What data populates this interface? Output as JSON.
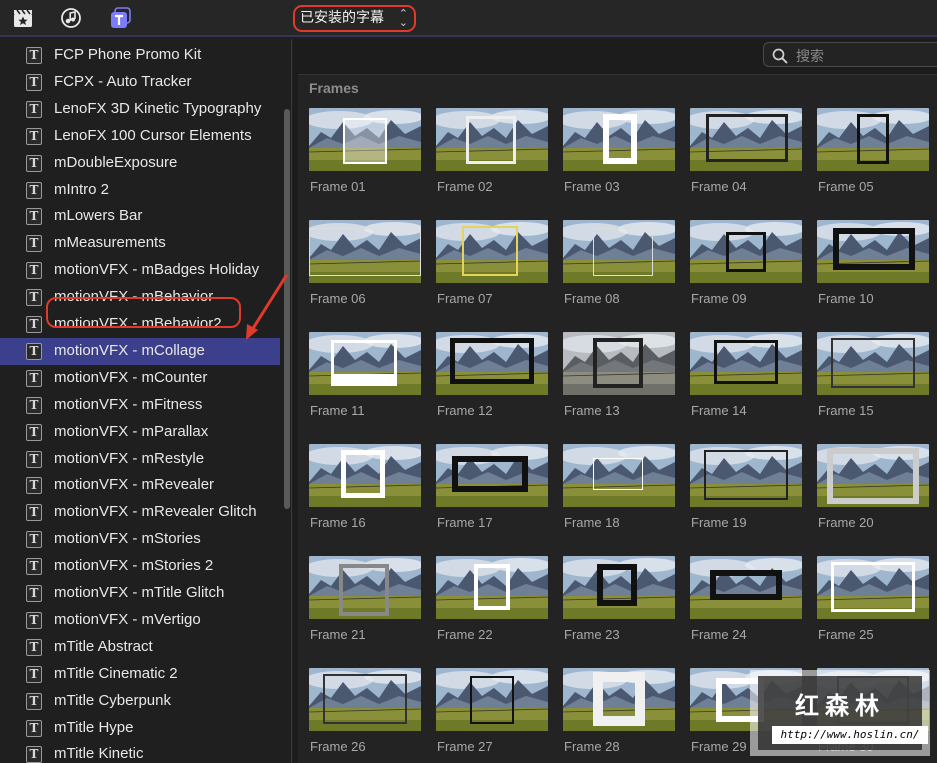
{
  "toolbar": {
    "source_select": "已安装的字幕",
    "icons": [
      "clapboard-star-icon",
      "music-photo-icon",
      "titles-icon"
    ],
    "accent": "#7c7cff"
  },
  "search": {
    "placeholder": "搜索"
  },
  "sidebar": {
    "items": [
      {
        "label": "FCP Phone Promo Kit"
      },
      {
        "label": "FCPX - Auto Tracker"
      },
      {
        "label": "LenoFX 3D Kinetic Typography"
      },
      {
        "label": "LenoFX 100 Cursor Elements"
      },
      {
        "label": "mDoubleExposure"
      },
      {
        "label": "mIntro 2"
      },
      {
        "label": "mLowers Bar"
      },
      {
        "label": "mMeasurements"
      },
      {
        "label": "motionVFX - mBadges Holiday"
      },
      {
        "label": "motionVFX - mBehavior"
      },
      {
        "label": "motionVFX - mBehavior2"
      },
      {
        "label": "motionVFX - mCollage",
        "selected": true
      },
      {
        "label": "motionVFX - mCounter"
      },
      {
        "label": "motionVFX - mFitness"
      },
      {
        "label": "motionVFX - mParallax"
      },
      {
        "label": "motionVFX - mRestyle"
      },
      {
        "label": "motionVFX - mRevealer"
      },
      {
        "label": "motionVFX - mRevealer Glitch"
      },
      {
        "label": "motionVFX - mStories"
      },
      {
        "label": "motionVFX - mStories 2"
      },
      {
        "label": "motionVFX - mTitle Glitch"
      },
      {
        "label": "motionVFX - mVertigo"
      },
      {
        "label": "mTitle Abstract"
      },
      {
        "label": "mTitle Cinematic 2"
      },
      {
        "label": "mTitle Cyberpunk"
      },
      {
        "label": "mTitle Hype"
      },
      {
        "label": "mTitle Kinetic"
      }
    ],
    "selected_color": "#3b3f8c",
    "highlight_color": "#e03a2a"
  },
  "browser": {
    "section_title": "Frames",
    "tiles": [
      {
        "label": "Frame 01"
      },
      {
        "label": "Frame 02"
      },
      {
        "label": "Frame 03"
      },
      {
        "label": "Frame 04"
      },
      {
        "label": "Frame 05"
      },
      {
        "label": "Frame 06"
      },
      {
        "label": "Frame 07"
      },
      {
        "label": "Frame 08"
      },
      {
        "label": "Frame 09"
      },
      {
        "label": "Frame 10"
      },
      {
        "label": "Frame 11"
      },
      {
        "label": "Frame 12"
      },
      {
        "label": "Frame 13"
      },
      {
        "label": "Frame 14"
      },
      {
        "label": "Frame 15"
      },
      {
        "label": "Frame 16"
      },
      {
        "label": "Frame 17"
      },
      {
        "label": "Frame 18"
      },
      {
        "label": "Frame 19"
      },
      {
        "label": "Frame 20"
      },
      {
        "label": "Frame 21"
      },
      {
        "label": "Frame 22"
      },
      {
        "label": "Frame 23"
      },
      {
        "label": "Frame 24"
      },
      {
        "label": "Frame 25"
      },
      {
        "label": "Frame 26"
      },
      {
        "label": "Frame 27"
      },
      {
        "label": "Frame 28"
      },
      {
        "label": "Frame 29"
      },
      {
        "label": "Frame 30"
      }
    ]
  },
  "watermark": {
    "title": "红森林",
    "url": "http://www.hoslin.cn/"
  }
}
